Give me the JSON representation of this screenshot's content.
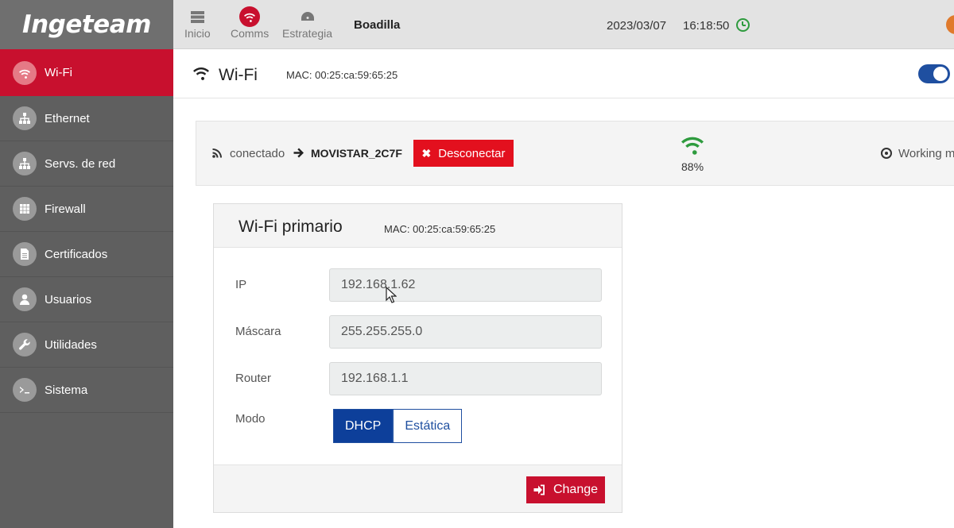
{
  "brand": {
    "logo_text": "Ingeteam"
  },
  "sidebar": {
    "items": [
      {
        "label": "Wi-Fi",
        "icon": "wifi-icon",
        "active": true
      },
      {
        "label": "Ethernet",
        "icon": "network-icon"
      },
      {
        "label": "Servs. de red",
        "icon": "network-services-icon"
      },
      {
        "label": "Firewall",
        "icon": "grid-icon"
      },
      {
        "label": "Certificados",
        "icon": "document-icon"
      },
      {
        "label": "Usuarios",
        "icon": "user-icon"
      },
      {
        "label": "Utilidades",
        "icon": "wrench-icon"
      },
      {
        "label": "Sistema",
        "icon": "terminal-icon"
      }
    ]
  },
  "topbar": {
    "nav": [
      {
        "label": "Inicio",
        "icon": "server-icon"
      },
      {
        "label": "Comms",
        "icon": "wifi-icon"
      },
      {
        "label": "Estrategia",
        "icon": "dashboard-icon"
      }
    ],
    "site_name": "Boadilla",
    "date": "2023/03/07",
    "time": "16:18:50"
  },
  "section": {
    "title": "Wi-Fi",
    "mac": "MAC: 00:25:ca:59:65:25",
    "enabled": true
  },
  "status": {
    "state_label": "conectado",
    "ssid": "MOVISTAR_2C7F",
    "disconnect_label": "Desconectar",
    "signal": "88%",
    "working_label": "Working m"
  },
  "card": {
    "title": "Wi-Fi primario",
    "mac": "MAC: 00:25:ca:59:65:25",
    "fields": {
      "ip": {
        "label": "IP",
        "value": "192.168.1.62"
      },
      "mask": {
        "label": "Máscara",
        "value": "255.255.255.0"
      },
      "router": {
        "label": "Router",
        "value": "192.168.1.1"
      }
    },
    "mode": {
      "label": "Modo",
      "options": [
        "DHCP",
        "Estática"
      ],
      "selected": "DHCP"
    },
    "change_label": "Change"
  },
  "colors": {
    "accent_red": "#c8102e",
    "primary_blue": "#0d3f9a",
    "signal_green": "#2e9b3e",
    "sidebar_bg": "#5f5f5f"
  }
}
